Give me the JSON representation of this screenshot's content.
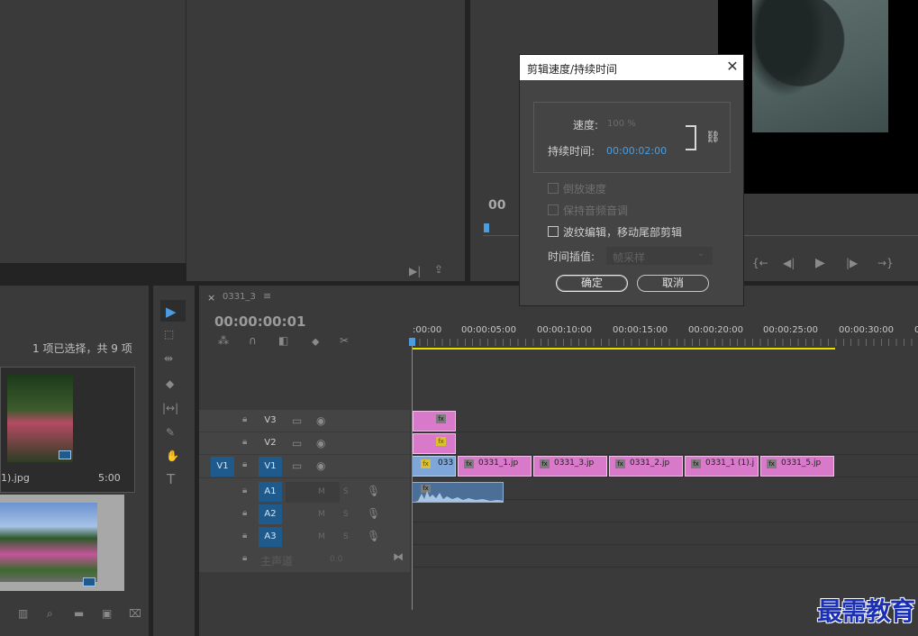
{
  "program": {
    "timecode": "00",
    "transport_icons": [
      "mark-in-icon",
      "step-back-icon",
      "play-icon",
      "step-forward-icon",
      "mark-out-icon"
    ],
    "transport_glyphs": [
      "{←",
      "◀|",
      "▶",
      "|▶",
      "→}"
    ]
  },
  "source": {
    "icons": [
      "export-frame-icon",
      "share-icon"
    ],
    "glyphs": [
      "▶|",
      "⇪"
    ]
  },
  "project": {
    "selection_status": "1 项已选择，共 9 项",
    "items": [
      {
        "name": "1).jpg",
        "duration": "5:00"
      }
    ]
  },
  "tools": [
    "▶",
    "⬚",
    "⇹",
    "◆",
    "|↔|",
    "✎",
    "✋",
    "T"
  ],
  "timeline": {
    "tab_close": "×",
    "tab_name": "0331_3",
    "tab_menu": "≡",
    "timecode": "00:00:00:01",
    "ruler_labels": [
      ":00:00",
      "00:00:05:00",
      "00:00:10:00",
      "00:00:15:00",
      "00:00:20:00",
      "00:00:25:00",
      "00:00:30:00",
      "0"
    ],
    "video_tracks": [
      {
        "source": "",
        "name": "V3"
      },
      {
        "source": "",
        "name": "V2"
      },
      {
        "source": "V1",
        "name": "V1"
      }
    ],
    "audio_tracks": [
      {
        "name": "A1",
        "m": "M",
        "s": "S"
      },
      {
        "name": "A2",
        "m": "M",
        "s": "S"
      },
      {
        "name": "A3",
        "m": "M",
        "s": "S"
      }
    ],
    "master": {
      "label": "主声道",
      "value": "0.0"
    },
    "v1_clips": [
      "033",
      "0331_1.jp",
      "0331_3.jp",
      "0331_2.jp",
      "0331_1 (1).j",
      "0331_5.jp"
    ],
    "fx": "fx"
  },
  "dialog": {
    "title": "剪辑速度/持续时间",
    "close": "✕",
    "speed_label": "速度:",
    "speed_value": "100 %",
    "duration_label": "持续时间:",
    "duration_value": "00:00:02:00",
    "reverse_label": "倒放速度",
    "keep_pitch_label": "保持音频音调",
    "ripple_label": "波纹编辑，移动尾部剪辑",
    "interp_label": "时间插值:",
    "interp_value": "帧采样",
    "ok": "确定",
    "cancel": "取消"
  },
  "watermark": "最需教育",
  "colors": {
    "accent_blue": "#4a9de0",
    "clip_pink": "#d879c9",
    "track_blue": "#1f5a8c",
    "ruler_yellow": "#e5e000"
  }
}
